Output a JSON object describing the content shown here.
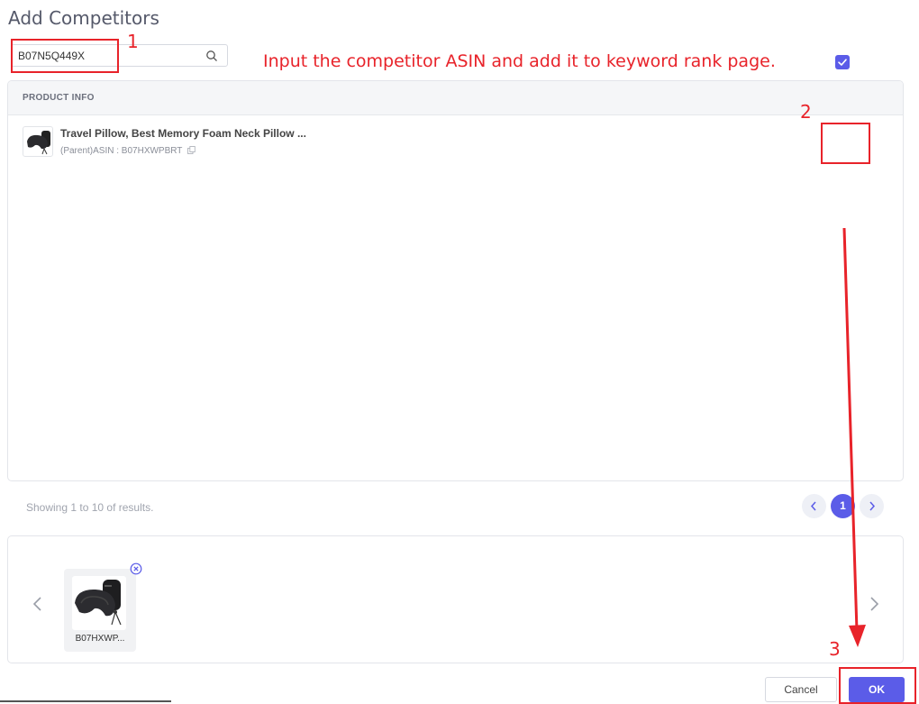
{
  "dialog": {
    "title": "Add Competitors"
  },
  "search": {
    "value": "B07N5Q449X",
    "icon": "search-icon"
  },
  "annotations": {
    "step1": "1",
    "step2": "2",
    "step3": "3",
    "instruction": "Input the competitor ASIN and add it to keyword rank page.",
    "color": "#e8232a"
  },
  "table": {
    "header": "PRODUCT INFO",
    "rows": [
      {
        "name": "Travel Pillow, Best Memory Foam Neck Pillow ...",
        "asin": "(Parent)ASIN : B07HXWPBRT",
        "checked": true
      }
    ]
  },
  "pagination": {
    "summary": "Showing 1 to 10 of results.",
    "current_page": "1"
  },
  "selected": {
    "items": [
      {
        "label": "B07HXWP..."
      }
    ]
  },
  "buttons": {
    "cancel": "Cancel",
    "ok": "OK"
  },
  "colors": {
    "accent": "#5b5ce8"
  }
}
